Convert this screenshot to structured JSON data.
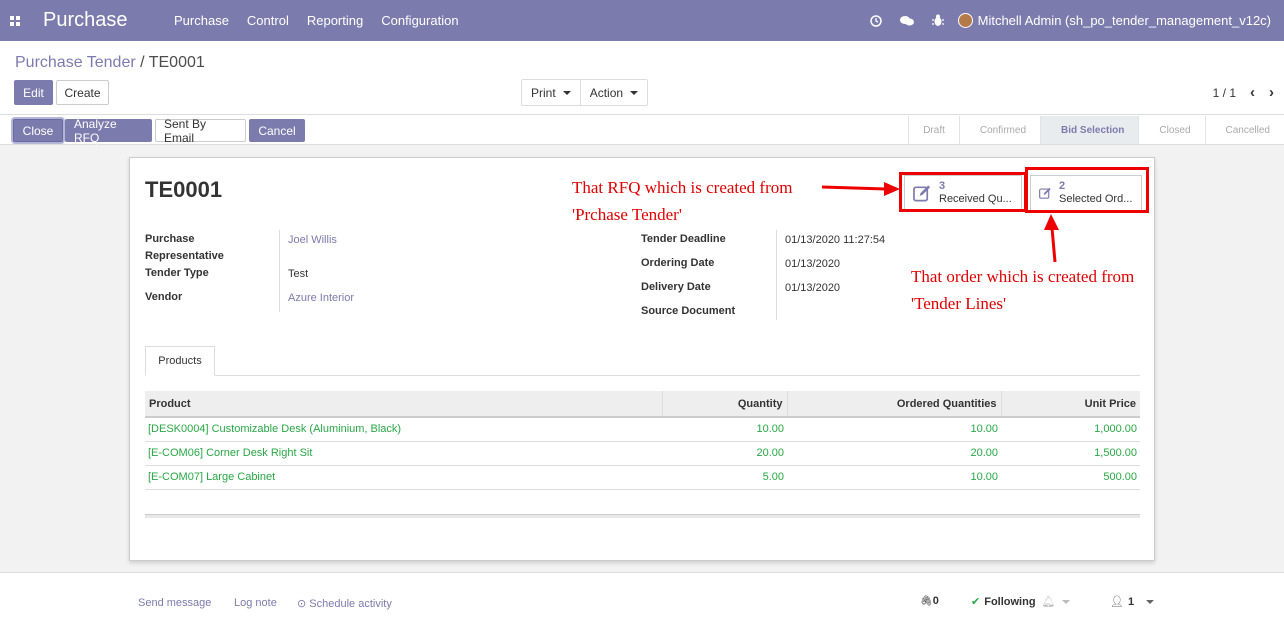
{
  "navbar": {
    "app_title": "Purchase",
    "menu": [
      "Purchase",
      "Control",
      "Reporting",
      "Configuration"
    ],
    "user": "Mitchell Admin (sh_po_tender_management_v12c)",
    "icons": [
      "clock-icon",
      "chat-icon",
      "bug-icon"
    ]
  },
  "breadcrumb": {
    "parent": "Purchase Tender",
    "separator": "/",
    "current": "TE0001"
  },
  "buttons": {
    "edit": "Edit",
    "create": "Create",
    "print": "Print",
    "action": "Action"
  },
  "pager": {
    "value": "1 / 1"
  },
  "statusbar": {
    "buttons": {
      "close": "Close",
      "analyze": "Analyze RFQ",
      "email": "Sent By Email",
      "cancel": "Cancel"
    },
    "stages": [
      "Draft",
      "Confirmed",
      "Bid Selection",
      "Closed",
      "Cancelled"
    ],
    "active_stage": "Bid Selection"
  },
  "form": {
    "title": "TE0001",
    "smart_buttons": [
      {
        "count": "3",
        "label": "Received Qu..."
      },
      {
        "count": "2",
        "label": "Selected Ord..."
      }
    ],
    "left_fields": {
      "rep_label_1": "Purchase",
      "rep_label_2": "Representative",
      "rep_value": "Joel Willis",
      "type_label": "Tender Type",
      "type_value": "Test",
      "vendor_label": "Vendor",
      "vendor_value": "Azure Interior"
    },
    "right_fields": {
      "deadline_label": "Tender Deadline",
      "deadline_value": "01/13/2020 11:27:54",
      "ordering_label": "Ordering Date",
      "ordering_value": "01/13/2020",
      "delivery_label": "Delivery Date",
      "delivery_value": "01/13/2020",
      "source_label": "Source Document",
      "source_value": ""
    },
    "tab": "Products",
    "table": {
      "headers": [
        "Product",
        "Quantity",
        "Ordered Quantities",
        "Unit Price"
      ],
      "rows": [
        [
          "[DESK0004] Customizable Desk (Aluminium, Black)",
          "10.00",
          "10.00",
          "1,000.00"
        ],
        [
          "[E-COM06] Corner Desk Right Sit",
          "20.00",
          "20.00",
          "1,500.00"
        ],
        [
          "[E-COM07] Large Cabinet",
          "5.00",
          "10.00",
          "500.00"
        ]
      ]
    }
  },
  "annotations": {
    "rfq_1": "That RFQ which is created from",
    "rfq_2": "'Prchase Tender'",
    "order_1": "That order which is created from",
    "order_2": "'Tender Lines'"
  },
  "chatter": {
    "send_message": "Send message",
    "log_note": "Log note",
    "schedule": "Schedule activity",
    "attachments": "0",
    "following": "Following",
    "followers": "1"
  },
  "colors": {
    "brand": "#7c7bad",
    "link_green": "#28a745",
    "annotation_red": "#e00000"
  }
}
